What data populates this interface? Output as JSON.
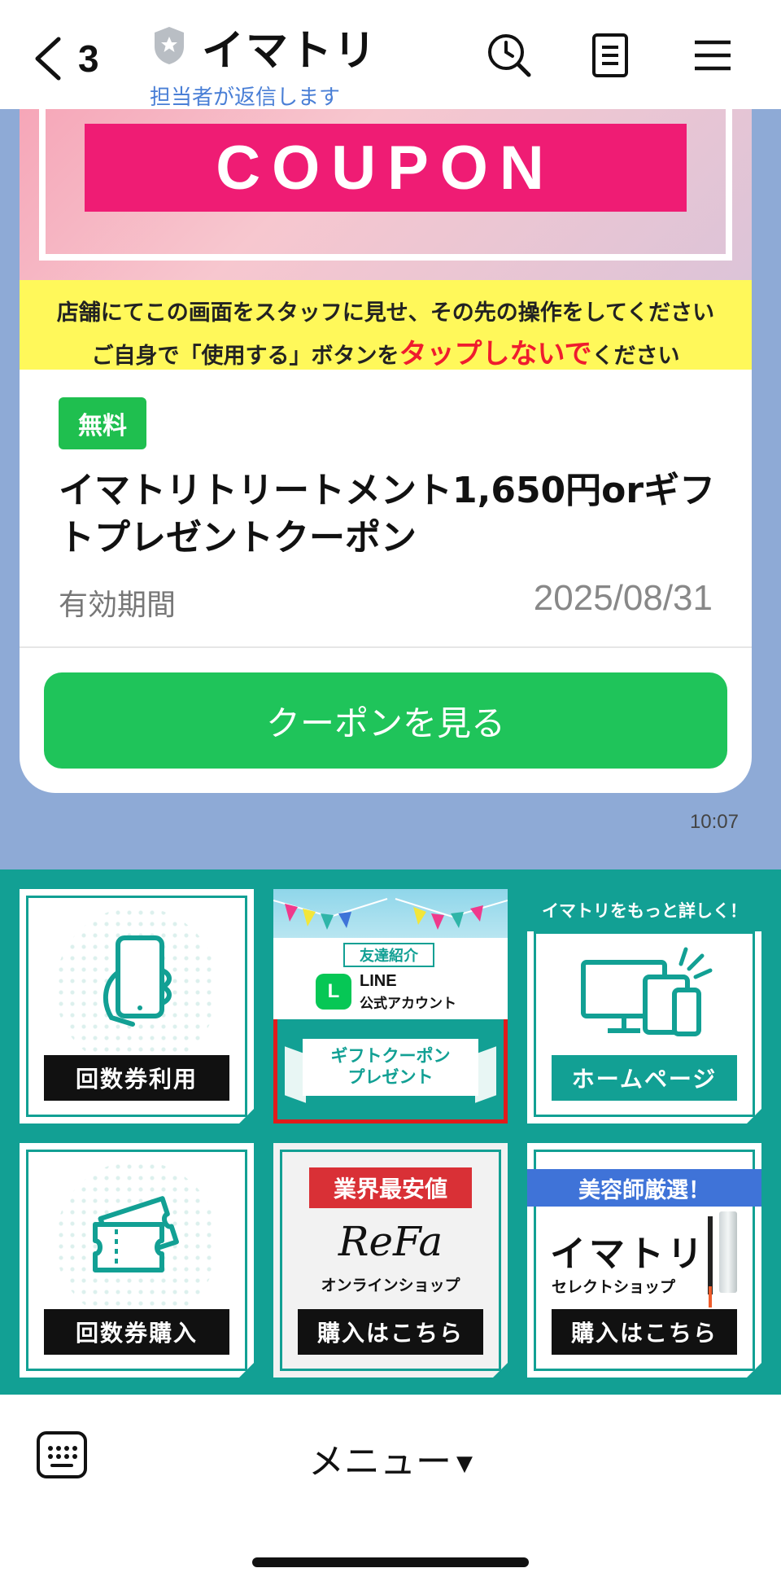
{
  "header": {
    "back_count": "3",
    "title": "イマトリ",
    "subtitle": "担当者が返信します",
    "icons": [
      "back-chevron-icon",
      "shield-star-icon",
      "search-clock-icon",
      "notes-icon",
      "hamburger-menu-icon"
    ]
  },
  "coupon": {
    "banner_word": "COUPON",
    "notice_line1": "店舗にてこの画面をスタッフに見せ、その先の操作をしてください",
    "notice_line2_pre": "ご自身で「使用する」ボタンを",
    "notice_line2_red": "タップしないで",
    "notice_line2_post": "ください",
    "badge": "無料",
    "title": "イマトリトリートメント1,650円orギフトプレゼントクーポン",
    "valid_label": "有効期間",
    "valid_date": "2025/08/31",
    "button_label": "クーポンを見る",
    "time": "10:07"
  },
  "richmenu": {
    "tiles": [
      {
        "label": "回数券利用",
        "icon": "smartphone-hand-icon"
      },
      {
        "tag": "友達紹介",
        "line_logo": "L",
        "line_title": "LINE",
        "line_sub": "公式アカウント",
        "ribbon": "ギフトクーポン\nプレゼント"
      },
      {
        "header": "イマトリをもっと詳しく！",
        "label": "ホームページ",
        "icon": "devices-icon"
      },
      {
        "label": "回数券購入",
        "icon": "tickets-icon"
      },
      {
        "banner": "業界最安値",
        "logo": "ReFa",
        "sub": "オンラインショップ",
        "label": "購入はこちら"
      },
      {
        "header": "美容師厳選！",
        "logo": "イマトリ",
        "sub": "セレクトショップ",
        "label": "購入はこちら"
      }
    ]
  },
  "bottombar": {
    "menu_label": "メニュー",
    "menu_arrow": "▼",
    "keyboard_icon": "keyboard-icon"
  },
  "colors": {
    "chat_bg": "#8eaad6",
    "line_green": "#1fc45a",
    "richmenu_teal": "#12a094",
    "coupon_pink": "#ef1c74",
    "notice_yellow": "#fff85a",
    "highlight_red": "#e11b1b",
    "subtitle_blue": "#4a7fd6"
  }
}
